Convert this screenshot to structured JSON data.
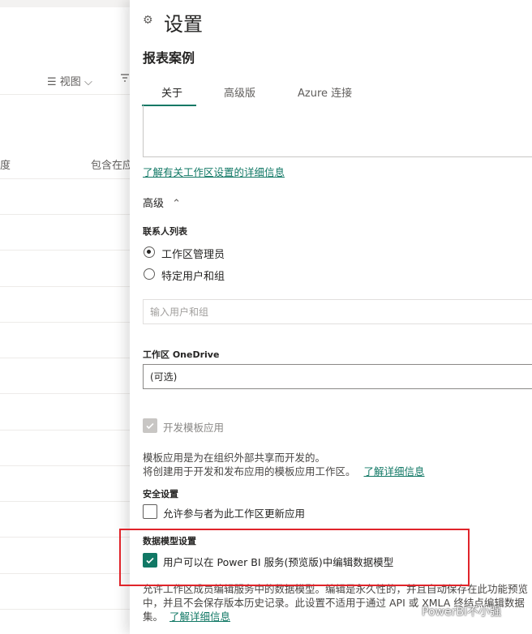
{
  "background": {
    "toolbar": {
      "view_label": "视图",
      "view_chevron": "⌵",
      "filter_icon": "filter-icon"
    },
    "columns": {
      "col1_partial": "度",
      "col2_partial": "包含在应"
    }
  },
  "panel": {
    "title": "设置",
    "subtitle": "报表案例",
    "tabs": [
      {
        "label": "关于"
      },
      {
        "label": "高级版"
      },
      {
        "label": "Azure 连接"
      }
    ],
    "learn_more_workspace": "了解有关工作区设置的详细信息",
    "advanced_label": "高级",
    "advanced_chevron": "⌃",
    "contact_list": {
      "label": "联系人列表",
      "options": [
        {
          "label": "工作区管理员",
          "checked": true
        },
        {
          "label": "特定用户和组",
          "checked": false
        }
      ],
      "input_placeholder": "输入用户和组"
    },
    "onedrive": {
      "label": "工作区 OneDrive",
      "value": "(可选)"
    },
    "template_app": {
      "checkbox_label": "开发模板应用",
      "desc_line1": "模板应用是为在组织外部共享而开发的。",
      "desc_line2": "将创建用于开发和发布应用的模板应用工作区。",
      "learn_more": "了解详细信息"
    },
    "security": {
      "label": "安全设置",
      "checkbox_label": "允许参与者为此工作区更新应用"
    },
    "data_model": {
      "label": "数据模型设置",
      "checkbox_label": "用户可以在 Power BI 服务(预览版)中编辑数据模型",
      "desc_line1": "允许工作区成员编辑服务中的数据模型。编辑是永久性的，并且自动保存在此功能预览",
      "desc_line2": "中，并且不会保存版本历史记录。此设置不适用于通过 API 或 XMLA 终结点编辑数据",
      "desc_line3_prefix": "集。",
      "learn_more": "了解详细信息"
    },
    "watermark": "PowerBI不小强"
  },
  "colors": {
    "accent": "#117865",
    "highlight": "#e0242a"
  }
}
